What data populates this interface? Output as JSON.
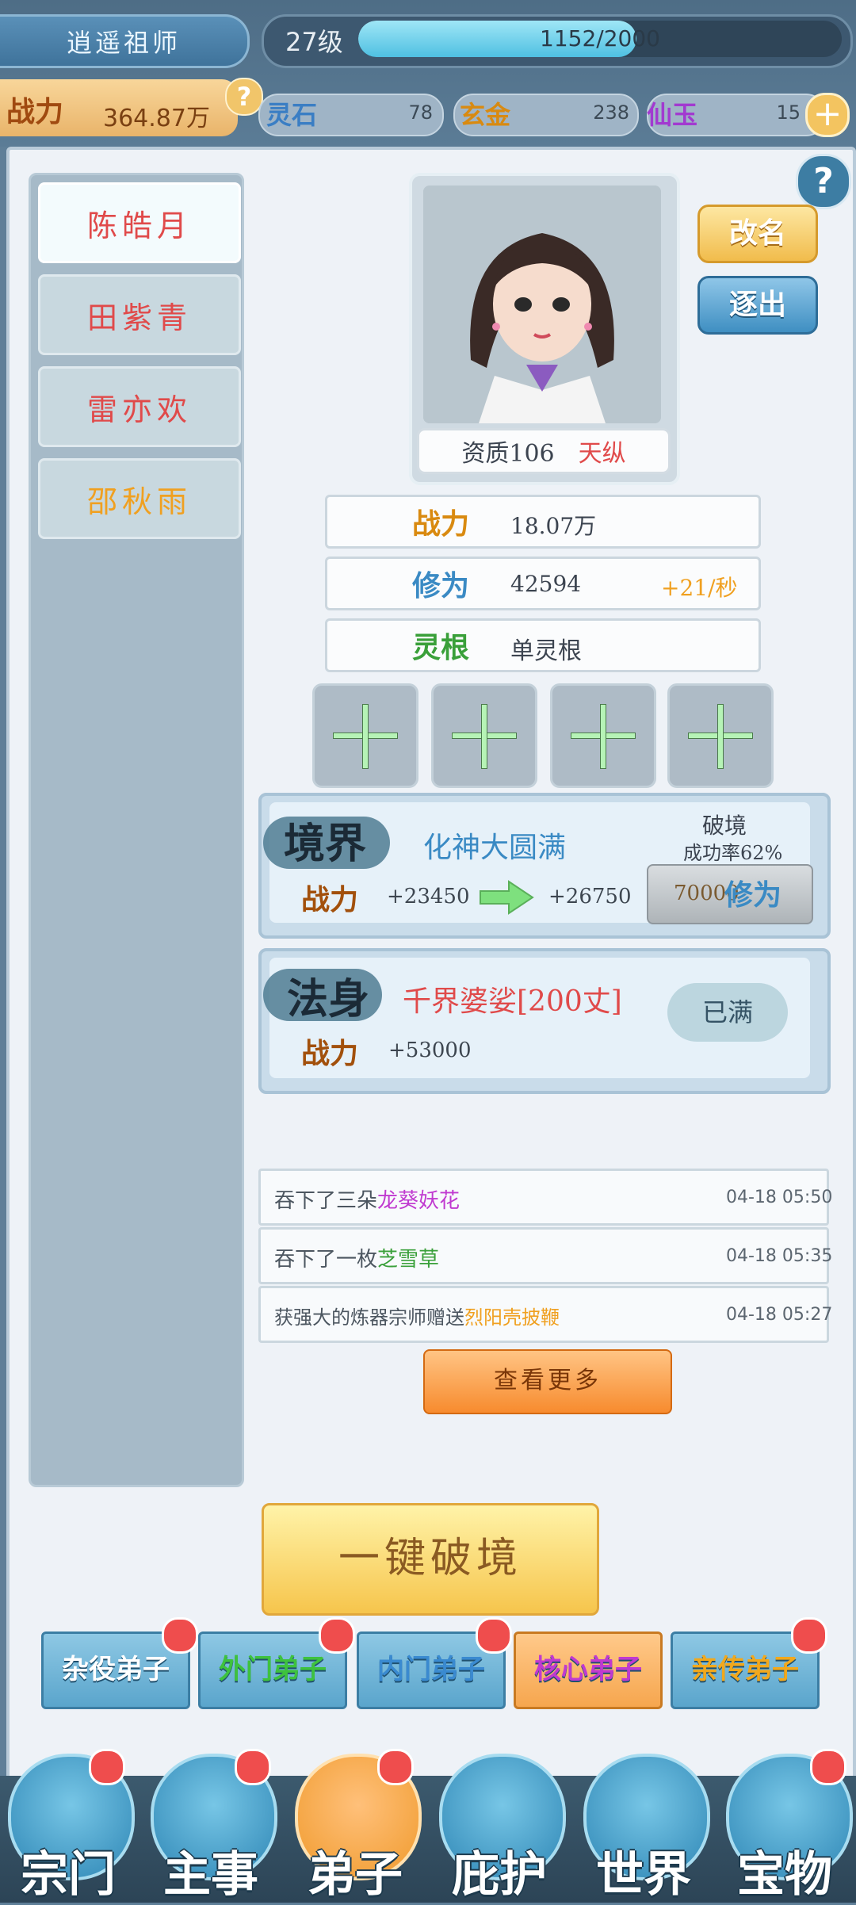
{
  "header": {
    "player_name": "逍遥祖师",
    "level": "27级",
    "xp_text": "1152/2000",
    "xp_fraction": 0.576,
    "power_label": "战力",
    "power_value": "364.87万",
    "help_glyph": "?",
    "resources": [
      {
        "label": "灵石",
        "value": "78",
        "color": "#3a7ec4"
      },
      {
        "label": "玄金",
        "value": "238",
        "color": "#d98a10"
      },
      {
        "label": "仙玉",
        "value": "15",
        "color": "#a23ad0"
      }
    ],
    "add_glyph": "+"
  },
  "disciples": [
    {
      "name": "陈皓月",
      "color": "#e04a4a",
      "active": true
    },
    {
      "name": "田紫青",
      "color": "#e04a4a",
      "active": false
    },
    {
      "name": "雷亦欢",
      "color": "#e04a4a",
      "active": false
    },
    {
      "name": "邵秋雨",
      "color": "#f0a020",
      "active": false
    }
  ],
  "profile": {
    "quality_label": "资质106",
    "quality_grade": "天纵",
    "rename_label": "改名",
    "exit_label": "逐出",
    "stats": [
      {
        "label": "战力",
        "value": "18.07万",
        "extra": "",
        "label_color": "#d98a10"
      },
      {
        "label": "修为",
        "value": "42594",
        "extra": "+21/秒",
        "label_color": "#3a8ac4"
      },
      {
        "label": "灵根",
        "value": "单灵根",
        "extra": "",
        "label_color": "#3aa03a"
      }
    ],
    "plus_glyph": "+"
  },
  "realm": {
    "title": "境界",
    "name": "化神大圆满",
    "break_label": "破境",
    "success_rate": "成功率62%",
    "power_label": "战力",
    "power_from": "+23450",
    "power_to": "+26750",
    "cost_value": "70000",
    "cost_label": "修为"
  },
  "body": {
    "title": "法身",
    "name": "千界婆娑[200丈]",
    "power_label": "战力",
    "power_value": "+53000",
    "status": "已满"
  },
  "log": [
    {
      "prefix": "吞下了三朵",
      "item": "龙葵妖花",
      "item_color": "#c03ad0",
      "time": "04-18 05:50"
    },
    {
      "prefix": "吞下了一枚",
      "item": "芝雪草",
      "item_color": "#3aa03a",
      "time": "04-18 05:35"
    },
    {
      "prefix": "获强大的炼器宗师赠送",
      "item": "烈阳壳披鞭",
      "item_color": "#f0a020",
      "time": "04-18 05:27"
    }
  ],
  "more_label": "查看更多",
  "break_all_label": "一键破境",
  "tiers": [
    {
      "label": "杂役弟子",
      "color": "#ffffff",
      "active": false
    },
    {
      "label": "外门弟子",
      "color": "#3ec23e",
      "active": false
    },
    {
      "label": "内门弟子",
      "color": "#3a8ad0",
      "active": false
    },
    {
      "label": "核心弟子",
      "color": "#c03ad0",
      "active": true
    },
    {
      "label": "亲传弟子",
      "color": "#f2a81c",
      "active": false
    }
  ],
  "nav": [
    {
      "label": "宗门",
      "icon": "sect-icon",
      "active": false
    },
    {
      "label": "主事",
      "icon": "checklist-icon",
      "active": false
    },
    {
      "label": "弟子",
      "icon": "disciple-icon",
      "active": true
    },
    {
      "label": "庇护",
      "icon": "shield-beast-icon",
      "active": false
    },
    {
      "label": "世界",
      "icon": "scroll-brush-icon",
      "active": false
    },
    {
      "label": "宝物",
      "icon": "treasure-bag-icon",
      "active": false
    }
  ]
}
